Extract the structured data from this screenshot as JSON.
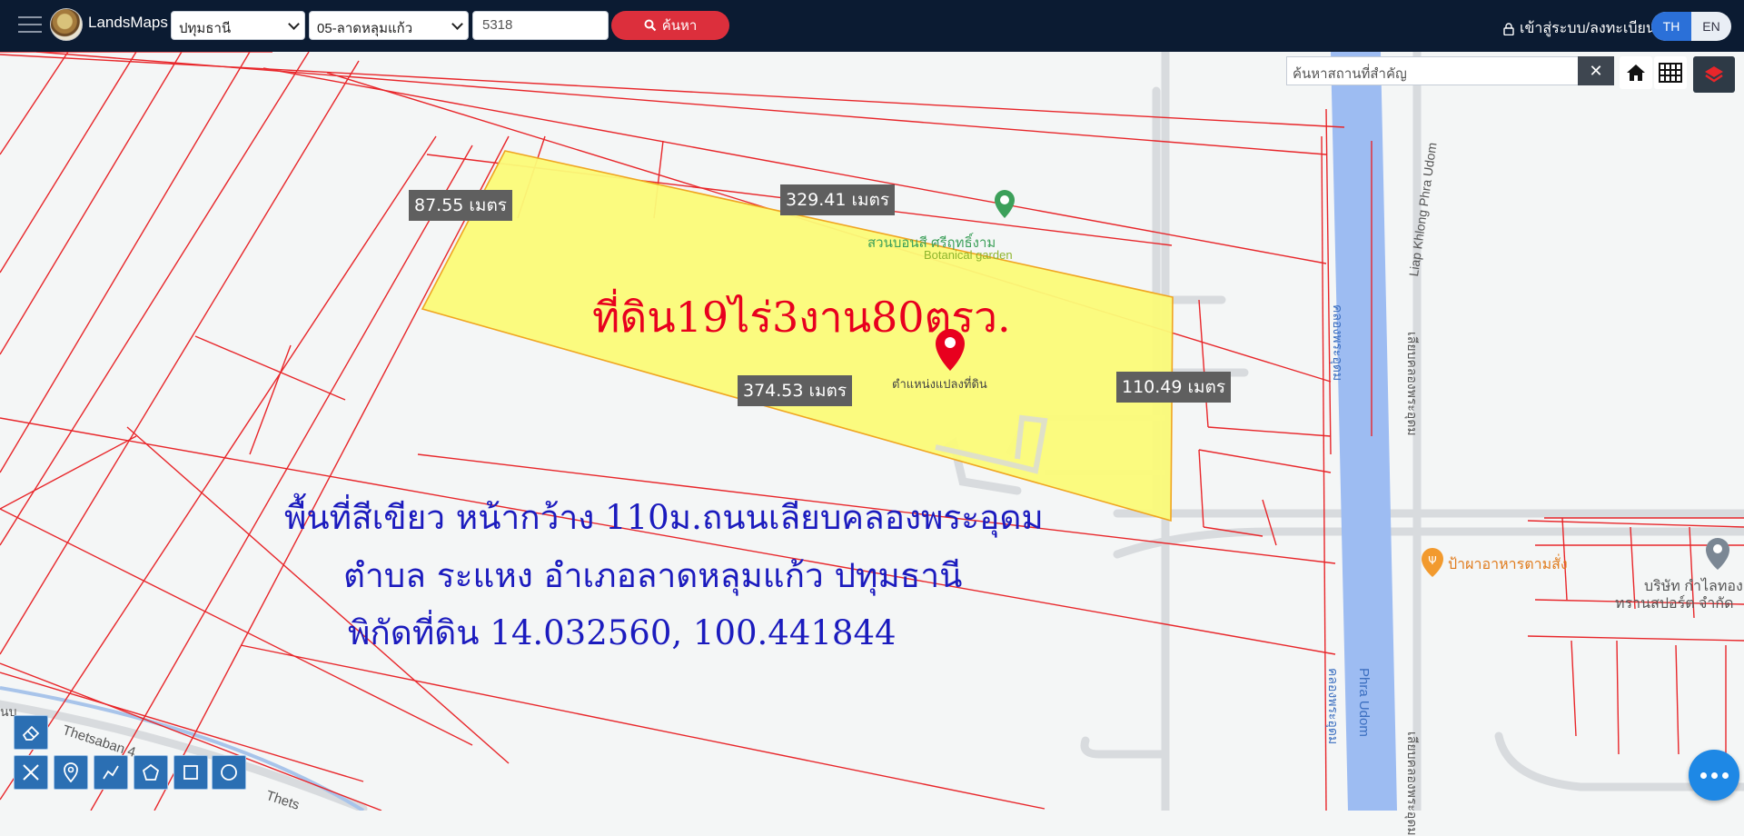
{
  "app": {
    "title": "LandsMaps"
  },
  "header": {
    "province": "ปทุมธานี",
    "district": "05-ลาดหลุมแก้ว",
    "parcel_number": "5318",
    "search_label": "ค้นหา",
    "login_label": "เข้าสู่ระบบ/ลงทะเบียน",
    "lang_th": "TH",
    "lang_en": "EN"
  },
  "place_search": {
    "placeholder": "ค้นหาสถานที่สำคัญ",
    "clear": "✕"
  },
  "map": {
    "side_lengths": [
      "87.55 เมตร",
      "329.41 เมตร",
      "374.53 เมตร",
      "110.49 เมตร"
    ],
    "parcel_pin_label": "ตำแหน่งแปลงที่ดิน",
    "area_text": "ที่ดิน19ไร่3งาน80ตรว.",
    "desc_line1": "พื้นที่สีเขียว หน้ากว้าง 110ม.ถนนเลียบคลองพระอุดม",
    "desc_line2": "ตำบล ระแหง อำเภอลาดหลุมแก้ว ปทุมธานี",
    "desc_line3": "พิกัดที่ดิน 14.032560, 100.441844",
    "poi": {
      "garden_th": "สวนบอนสี ศรีฤทธิ์งาม",
      "garden_en": "Botanical garden",
      "canal_th": "คลองพระอุดม",
      "canal_en": "Phra Udom",
      "road_liap": "Liap Khlong Phra Udom",
      "road_liap_th": "เลียบคลองพระอุดม",
      "food": "ป้าผาอาหารตามสั่ง",
      "company_line1": "บริษัท กำไลทอง",
      "company_line2": "ทรานสปอร์ต จำกัด",
      "thetsaban": "Thetsaban 4",
      "thetsaban_cut": "Thets",
      "left_edge": "ุนบ"
    }
  },
  "colors": {
    "topbar": "#0b1b32",
    "search_button": "#dc2f3c",
    "parcel_fill": "#fbfb78",
    "boundary": "#e8262a",
    "canal": "#9dbcf2"
  }
}
